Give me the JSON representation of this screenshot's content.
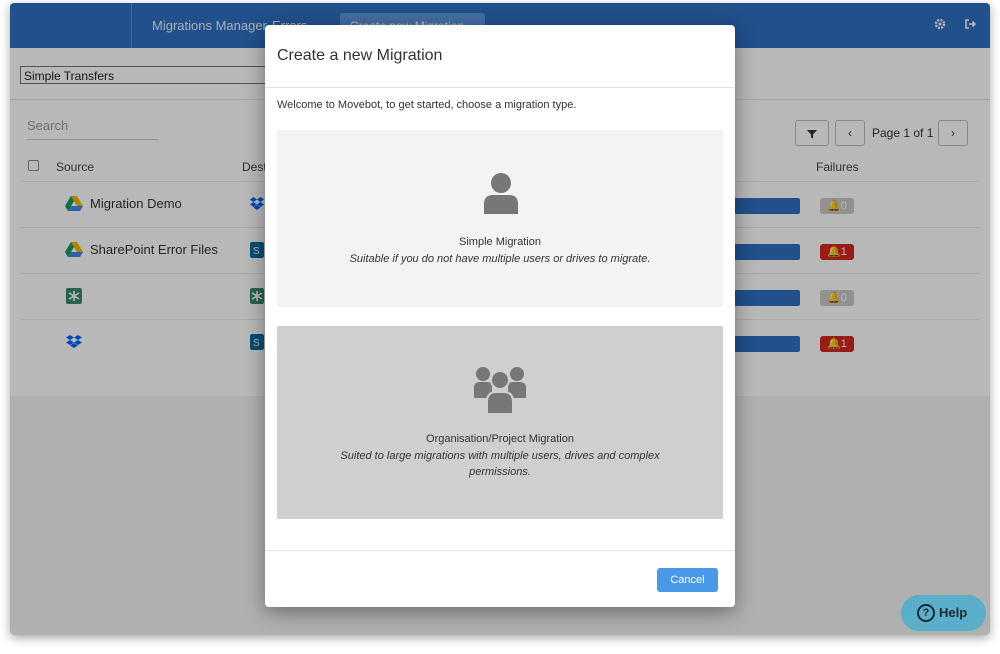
{
  "topbar": {
    "nav": [
      "Migrations Manager",
      "Errors",
      "Create new Migration"
    ],
    "icons": [
      "gear-icon",
      "logout-icon"
    ]
  },
  "content": {
    "transfer_select": "Simple Transfers",
    "search_placeholder": "Search",
    "pagination": {
      "page_label": "Page 1 of 1",
      "prev": "‹",
      "next": "›"
    },
    "columns": {
      "source": "Source",
      "destination": "Dest",
      "failures": "Failures"
    },
    "rows": [
      {
        "name": "Migration Demo",
        "source_icon": "google-drive-icon",
        "dest_icon": "dropbox-icon",
        "failures": "0",
        "failure_state": "none"
      },
      {
        "name": "SharePoint Error Files",
        "source_icon": "google-drive-icon",
        "dest_icon": "sharepoint-icon",
        "failures": "1",
        "failure_state": "error"
      },
      {
        "name": "",
        "source_icon": "egnyte-icon",
        "dest_icon": "egnyte-icon",
        "failures": "0",
        "failure_state": "none"
      },
      {
        "name": "",
        "source_icon": "dropbox-icon",
        "dest_icon": "sharepoint-icon",
        "failures": "1",
        "failure_state": "error"
      }
    ]
  },
  "modal": {
    "title": "Create a new Migration",
    "welcome": "Welcome to Movebot, to get started, choose a migration type.",
    "options": [
      {
        "title": "Simple Migration",
        "description": "Suitable if you do not have multiple users or drives to migrate.",
        "icon": "user-icon"
      },
      {
        "title": "Organisation/Project Migration",
        "description": "Suited to large migrations with multiple users, drives and complex permissions.",
        "icon": "users-group-icon"
      }
    ],
    "cancel_label": "Cancel"
  },
  "help": {
    "label": "Help",
    "icon": "question-icon"
  },
  "colors": {
    "brand_blue": "#2e6fc3",
    "failure_red": "#d4281f",
    "help_teal": "#5aaec9",
    "button_blue": "#4a98e8"
  }
}
